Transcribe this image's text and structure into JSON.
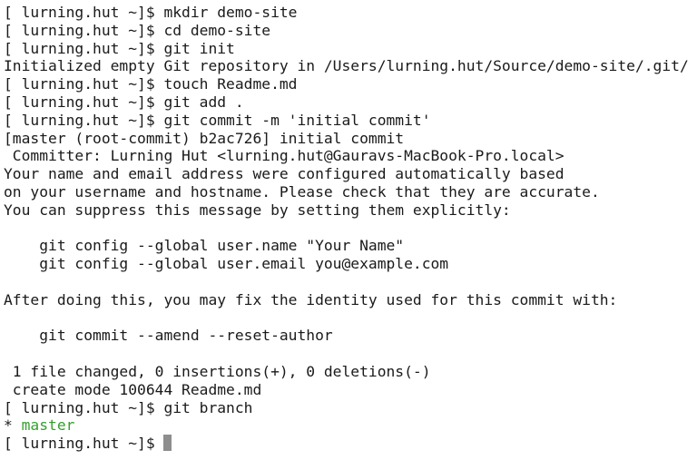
{
  "terminal": {
    "lines": [
      "[ lurning.hut ~]$ mkdir demo-site",
      "[ lurning.hut ~]$ cd demo-site",
      "[ lurning.hut ~]$ git init",
      "Initialized empty Git repository in /Users/lurning.hut/Source/demo-site/.git/",
      "[ lurning.hut ~]$ touch Readme.md",
      "[ lurning.hut ~]$ git add .",
      "[ lurning.hut ~]$ git commit -m 'initial commit'",
      "[master (root-commit) b2ac726] initial commit",
      " Committer: Lurning Hut <lurning.hut@Gauravs-MacBook-Pro.local>",
      "Your name and email address were configured automatically based",
      "on your username and hostname. Please check that they are accurate.",
      "You can suppress this message by setting them explicitly:",
      "",
      "    git config --global user.name \"Your Name\"",
      "    git config --global user.email you@example.com",
      "",
      "After doing this, you may fix the identity used for this commit with:",
      "",
      "    git commit --amend --reset-author",
      "",
      " 1 file changed, 0 insertions(+), 0 deletions(-)",
      " create mode 100644 Readme.md",
      "[ lurning.hut ~]$ git branch"
    ],
    "branch_marker": "* ",
    "branch_name": "master",
    "prompt": "[ lurning.hut ~]$ ",
    "colors": {
      "background": "#ffffff",
      "text": "#1a1a1a",
      "current_branch": "#35a02f",
      "cursor": "#8e8e8e"
    }
  }
}
